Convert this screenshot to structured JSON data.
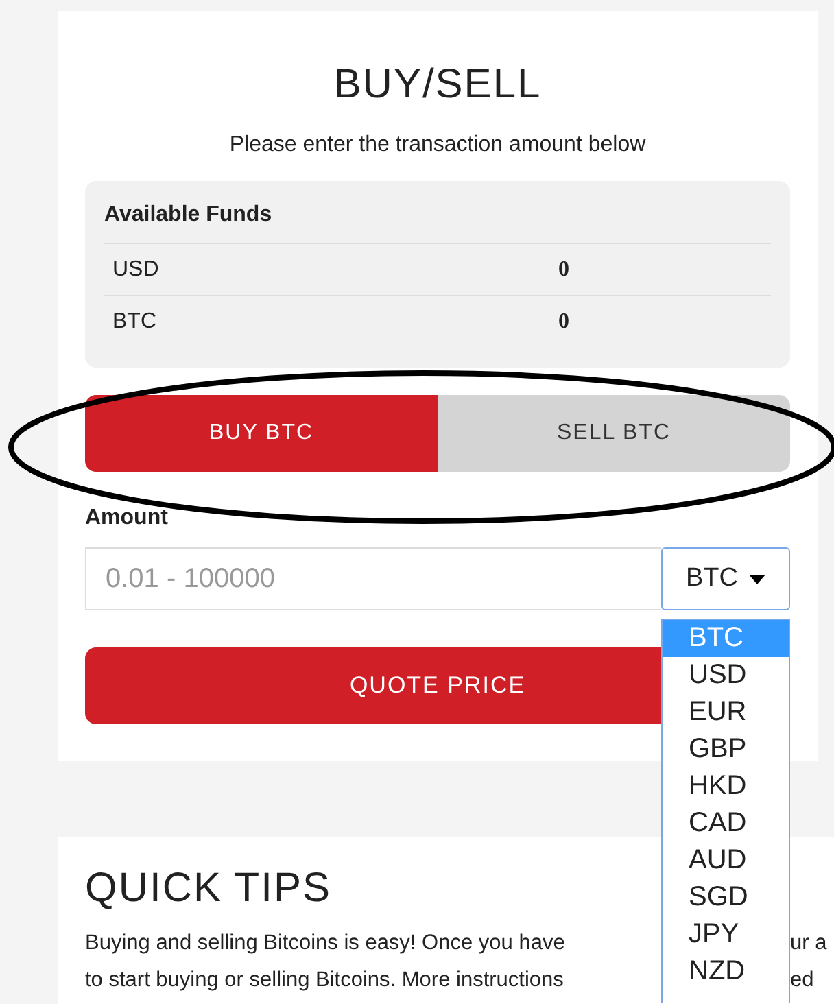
{
  "trade_card": {
    "title": "BUY/SELL",
    "subtitle": "Please enter the transaction amount below",
    "funds": {
      "heading": "Available Funds",
      "rows": [
        {
          "currency": "USD",
          "amount": "0"
        },
        {
          "currency": "BTC",
          "amount": "0"
        }
      ]
    },
    "mode_tabs": [
      {
        "label": "BUY BTC",
        "selected": true
      },
      {
        "label": "SELL BTC",
        "selected": false
      }
    ],
    "amount": {
      "label": "Amount",
      "placeholder": "0.01 - 100000"
    },
    "currency_select": {
      "value": "BTC",
      "expanded": true,
      "options": [
        {
          "label": "BTC",
          "selected": true
        },
        {
          "label": "USD",
          "selected": false
        },
        {
          "label": "EUR",
          "selected": false
        },
        {
          "label": "GBP",
          "selected": false
        },
        {
          "label": "HKD",
          "selected": false
        },
        {
          "label": "CAD",
          "selected": false
        },
        {
          "label": "AUD",
          "selected": false
        },
        {
          "label": "SGD",
          "selected": false
        },
        {
          "label": "JPY",
          "selected": false
        },
        {
          "label": "NZD",
          "selected": false
        }
      ]
    },
    "quote_button": "QUOTE PRICE"
  },
  "tips_card": {
    "title": "QUICK TIPS",
    "lines": [
      {
        "start": "Buying and selling Bitcoins is easy! Once you have",
        "end": "ur a"
      },
      {
        "start": "to start buying or selling Bitcoins. More instructions",
        "end": "ed"
      }
    ]
  },
  "annotation": {
    "kind": "ellipse"
  }
}
